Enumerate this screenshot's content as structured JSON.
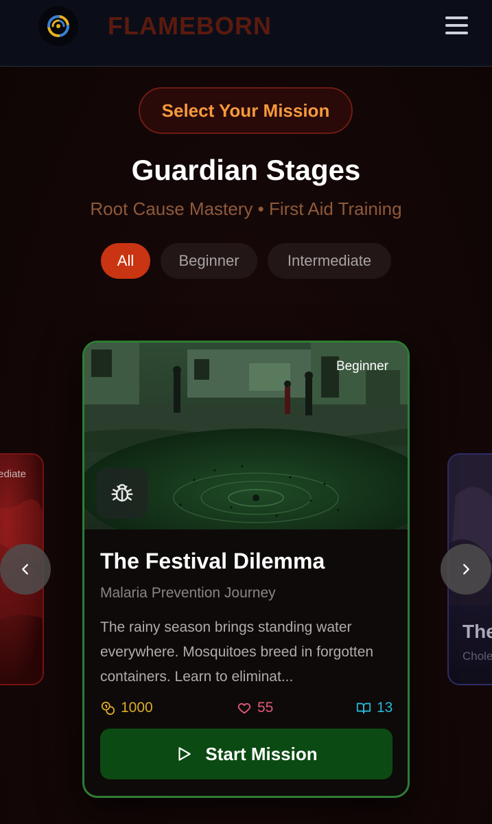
{
  "header": {
    "brand": "FLAMEBORN",
    "logo_icon": "spiral-logo-icon",
    "menu_icon": "hamburger-menu-icon"
  },
  "mission_pill": "Select Your Mission",
  "page_title": "Guardian Stages",
  "subtitle": "Root Cause Mastery • First Aid Training",
  "filters": [
    {
      "label": "All",
      "active": true
    },
    {
      "label": "Beginner",
      "active": false
    },
    {
      "label": "Intermediate",
      "active": false
    }
  ],
  "left_card": {
    "tag": "ediate"
  },
  "right_card": {
    "title": "The",
    "subtitle": "Chole"
  },
  "card": {
    "level": "Beginner",
    "title": "The Festival Dilemma",
    "subtitle": "Malaria Prevention Journey",
    "description": "The rainy season brings standing water everywhere. Mosquitoes breed in forgotten containers. Learn to eliminat...",
    "stats": {
      "coins": "1000",
      "likes": "55",
      "reads": "13"
    },
    "start_label": "Start Mission",
    "icon": "bug-icon"
  },
  "colors": {
    "accent_orange": "#f49a3c",
    "active_filter": "#c93412",
    "card_border": "#2f7d34",
    "start_button": "#0c4a13"
  }
}
